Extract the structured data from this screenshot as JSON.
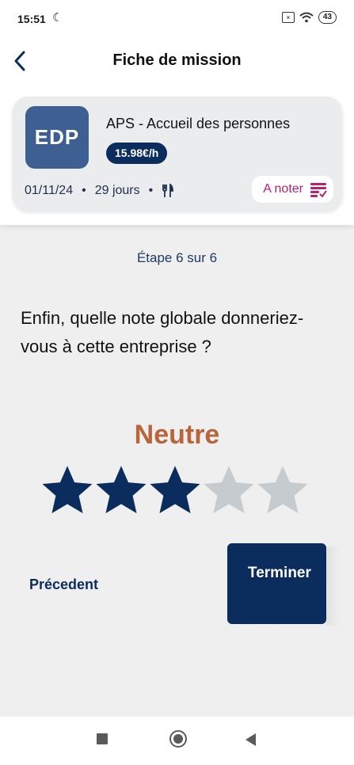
{
  "status_bar": {
    "time": "15:51",
    "battery": "43"
  },
  "header": {
    "title": "Fiche de mission"
  },
  "mission": {
    "logo": "EDP",
    "title": "APS - Accueil des personnes",
    "rate": "15.98€/h",
    "date": "01/11/24",
    "duration": "29 jours",
    "rate_action": "A noter"
  },
  "step": "Étape 6 sur 6",
  "question": "Enfin, quelle note globale donneriez-vous à cette entreprise ?",
  "rating": {
    "label": "Neutre",
    "value": 3,
    "max": 5,
    "filled_color": "#0b2d5e",
    "empty_color": "#c6cbcf"
  },
  "buttons": {
    "previous": "Précedent",
    "finish": "Terminer"
  },
  "colors": {
    "primary": "#0b2d5e",
    "accent": "#b4236e",
    "verdict": "#b8653a"
  }
}
